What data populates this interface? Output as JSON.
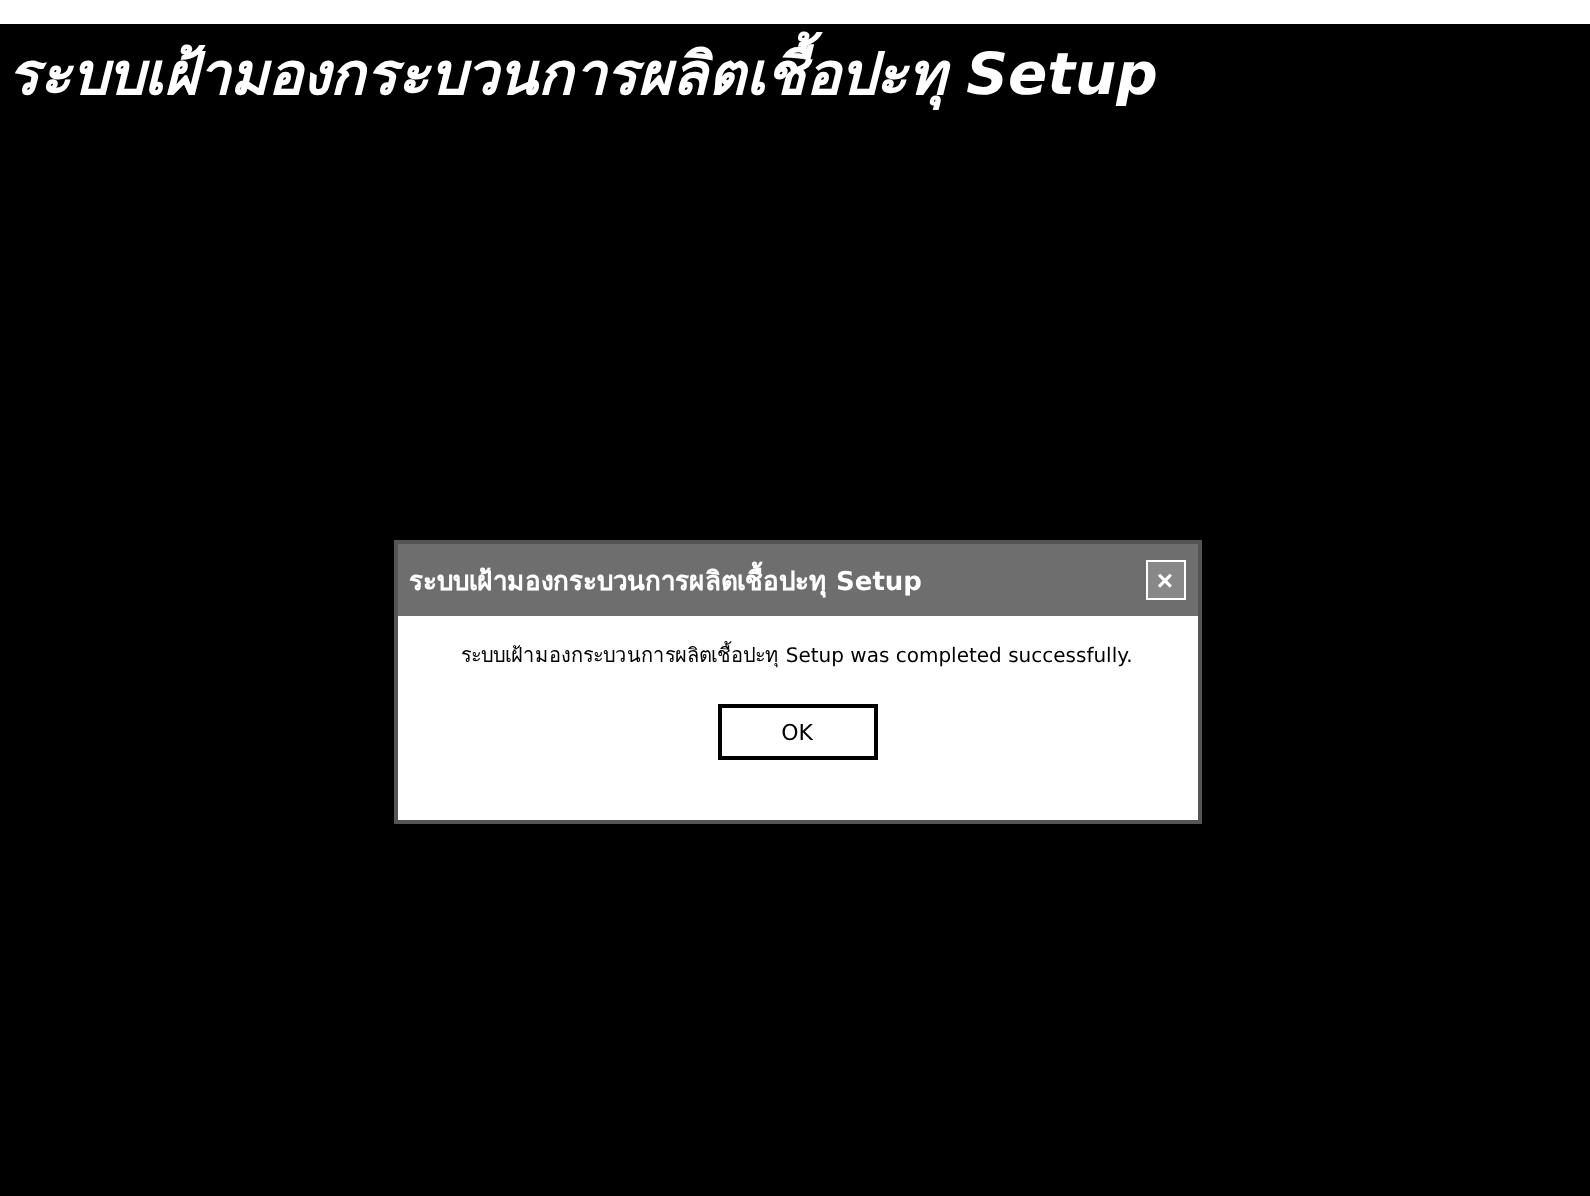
{
  "screen": {
    "title": "ระบบเฝ้ามองกระบวนการผลิตเชื้อปะทุ Setup"
  },
  "dialog": {
    "title": "ระบบเฝ้ามองกระบวนการผลิตเชื้อปะทุ Setup",
    "close": "×",
    "message": "ระบบเฝ้ามองกระบวนการผลิตเชื้อปะทุ  Setup was completed successfully.",
    "buttons": [
      "OK"
    ]
  }
}
